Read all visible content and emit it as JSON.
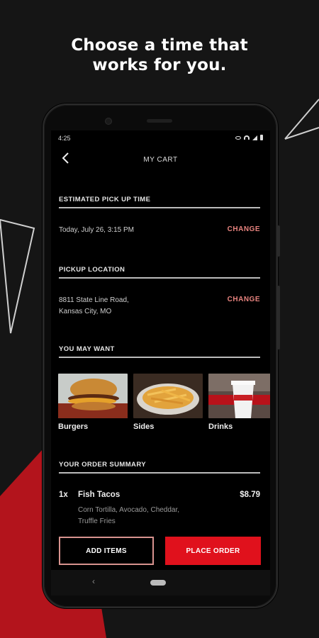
{
  "headline": {
    "line1": "Choose a time that",
    "line2": "works for you."
  },
  "colors": {
    "accent_red": "#e0111c",
    "change_link": "#e8847f",
    "background": "#151515"
  },
  "status_bar": {
    "time": "4:25",
    "icons": [
      "eye-icon",
      "wifi-icon",
      "signal-icon",
      "battery-icon"
    ]
  },
  "header": {
    "back_icon": "chevron-left-icon",
    "title": "MY CART"
  },
  "pickup_time": {
    "heading": "ESTIMATED PICK UP TIME",
    "value": "Today, July 26, 3:15 PM",
    "change_label": "CHANGE"
  },
  "pickup_location": {
    "heading": "PICKUP LOCATION",
    "address_line1": "8811 State Line Road,",
    "address_line2": "Kansas City, MO",
    "change_label": "CHANGE"
  },
  "you_may_want": {
    "heading": "YOU MAY WANT",
    "items": [
      {
        "label": "Burgers"
      },
      {
        "label": "Sides"
      },
      {
        "label": "Drinks"
      }
    ]
  },
  "order_summary": {
    "heading": "YOUR ORDER SUMMARY",
    "items": [
      {
        "qty": "1x",
        "name": "Fish Tacos",
        "price": "$8.79",
        "desc_line1": "Corn Tortilla, Avocado, Cheddar,",
        "desc_line2": "Truffle Fries"
      }
    ]
  },
  "actions": {
    "add_items": "ADD ITEMS",
    "place_order": "PLACE ORDER"
  },
  "nav": {
    "back_icon": "nav-back-icon",
    "home_icon": "nav-home-pill"
  }
}
